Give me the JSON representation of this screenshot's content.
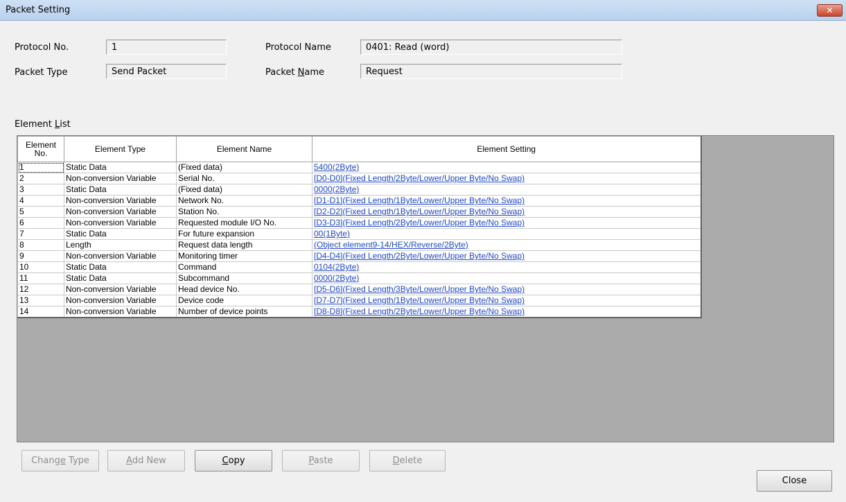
{
  "window": {
    "title": "Packet Setting",
    "close_glyph": "✕"
  },
  "form": {
    "protocol_no": {
      "label": "Protocol No.",
      "value": "1"
    },
    "protocol_name": {
      "label": "Protocol Name",
      "value": "0401: Read (word)"
    },
    "packet_type": {
      "label": "Packet Type",
      "value": "Send Packet"
    },
    "packet_name": {
      "label_pre": "Packet ",
      "label_u": "N",
      "label_post": "ame",
      "value": "Request"
    }
  },
  "element_list": {
    "label_pre": "Element ",
    "label_u": "L",
    "label_post": "ist",
    "headers": {
      "no_line1": "Element",
      "no_line2": "No.",
      "type": "Element Type",
      "name": "Element Name",
      "setting": "Element Setting"
    },
    "rows": [
      {
        "no": "1",
        "type": "Static Data",
        "name": "(Fixed data)",
        "setting": "5400(2Byte)"
      },
      {
        "no": "2",
        "type": "Non-conversion Variable",
        "name": "Serial No.",
        "setting": "[D0-D0](Fixed Length/2Byte/Lower/Upper Byte/No Swap)"
      },
      {
        "no": "3",
        "type": "Static Data",
        "name": "(Fixed data)",
        "setting": "0000(2Byte)"
      },
      {
        "no": "4",
        "type": "Non-conversion Variable",
        "name": "Network No.",
        "setting": "[D1-D1](Fixed Length/1Byte/Lower/Upper Byte/No Swap)"
      },
      {
        "no": "5",
        "type": "Non-conversion Variable",
        "name": "Station No.",
        "setting": "[D2-D2](Fixed Length/1Byte/Lower/Upper Byte/No Swap)"
      },
      {
        "no": "6",
        "type": "Non-conversion Variable",
        "name": "Requested module I/O No.",
        "setting": "[D3-D3](Fixed Length/2Byte/Lower/Upper Byte/No Swap)"
      },
      {
        "no": "7",
        "type": "Static Data",
        "name": "For future expansion",
        "setting": "00(1Byte)"
      },
      {
        "no": "8",
        "type": "Length",
        "name": "Request data length",
        "setting": "(Object element9-14/HEX/Reverse/2Byte)"
      },
      {
        "no": "9",
        "type": "Non-conversion Variable",
        "name": "Monitoring timer",
        "setting": "[D4-D4](Fixed Length/2Byte/Lower/Upper Byte/No Swap)"
      },
      {
        "no": "10",
        "type": "Static Data",
        "name": "Command",
        "setting": "0104(2Byte)"
      },
      {
        "no": "11",
        "type": "Static Data",
        "name": "Subcommand",
        "setting": "0000(2Byte)"
      },
      {
        "no": "12",
        "type": "Non-conversion Variable",
        "name": "Head device No.",
        "setting": "[D5-D6](Fixed Length/3Byte/Lower/Upper Byte/No Swap)"
      },
      {
        "no": "13",
        "type": "Non-conversion Variable",
        "name": "Device code",
        "setting": "[D7-D7](Fixed Length/1Byte/Lower/Upper Byte/No Swap)"
      },
      {
        "no": "14",
        "type": "Non-conversion Variable",
        "name": "Number of device points",
        "setting": "[D8-D8](Fixed Length/2Byte/Lower/Upper Byte/No Swap)"
      }
    ]
  },
  "buttons": {
    "change_type": {
      "pre": "Chang",
      "u": "e",
      "post": " Type",
      "enabled": false
    },
    "add_new": {
      "pre": "",
      "u": "A",
      "post": "dd New",
      "enabled": false
    },
    "copy": {
      "pre": "",
      "u": "C",
      "post": "opy",
      "enabled": true
    },
    "paste": {
      "pre": "",
      "u": "P",
      "post": "aste",
      "enabled": false
    },
    "delete": {
      "pre": "",
      "u": "D",
      "post": "elete",
      "enabled": false
    },
    "close": {
      "label": "Close",
      "enabled": true
    }
  }
}
